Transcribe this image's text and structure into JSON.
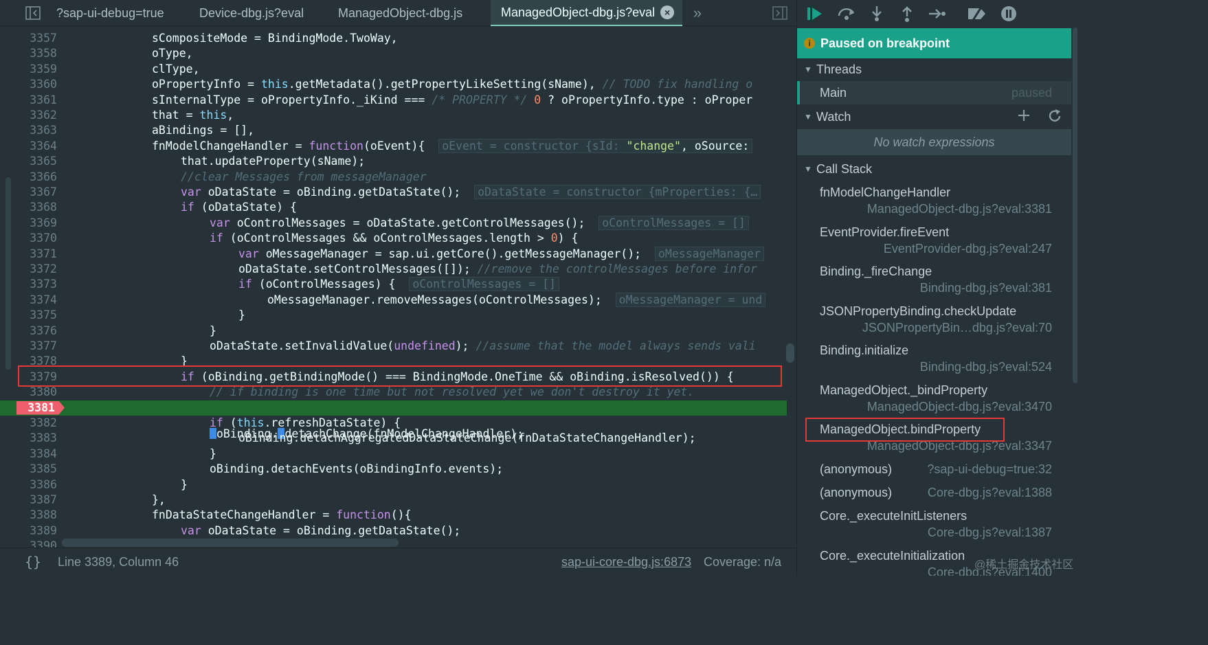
{
  "tabs": [
    {
      "label": "?sap-ui-debug=true",
      "active": false
    },
    {
      "label": "Device-dbg.js?eval",
      "active": false
    },
    {
      "label": "ManagedObject-dbg.js",
      "active": false
    },
    {
      "label": "ManagedObject-dbg.js?eval",
      "active": true,
      "close": "×"
    }
  ],
  "tabs_more": "»",
  "code_lines": [
    {
      "n": "3357"
    },
    {
      "n": "3358"
    },
    {
      "n": "3359"
    },
    {
      "n": "3360"
    },
    {
      "n": "3361"
    },
    {
      "n": "3362"
    },
    {
      "n": "3363"
    },
    {
      "n": "3364"
    },
    {
      "n": "3365"
    },
    {
      "n": "3366"
    },
    {
      "n": "3367"
    },
    {
      "n": "3368"
    },
    {
      "n": "3369"
    },
    {
      "n": "3370"
    },
    {
      "n": "3371"
    },
    {
      "n": "3372"
    },
    {
      "n": "3373"
    },
    {
      "n": "3374"
    },
    {
      "n": "3375"
    },
    {
      "n": "3376"
    },
    {
      "n": "3377"
    },
    {
      "n": "3378"
    },
    {
      "n": "3379"
    },
    {
      "n": "3380"
    },
    {
      "n": "3381"
    },
    {
      "n": "3382"
    },
    {
      "n": "3383"
    },
    {
      "n": "3384"
    },
    {
      "n": "3385"
    },
    {
      "n": "3386"
    },
    {
      "n": "3387"
    },
    {
      "n": "3388"
    },
    {
      "n": "3389"
    },
    {
      "n": "3390"
    }
  ],
  "code_text": {
    "l3357": "sCompositeMode = BindingMode.TwoWay,",
    "l3358": "oType,",
    "l3359": "clType,",
    "l3360a": "oPropertyInfo = ",
    "l3360b": "this",
    "l3360c": ".getMetadata().getPropertyLikeSetting(sName), ",
    "l3360d": "// TODO fix handling o",
    "l3361a": "sInternalType = oPropertyInfo._iKind === ",
    "l3361b": "/* PROPERTY */",
    "l3361c": " 0",
    "l3361d": " ? oPropertyInfo.type : oProper",
    "l3362a": "that = ",
    "l3362b": "this",
    "l3362c": ",",
    "l3363": "aBindings = [],",
    "l3364a": "fnModelChangeHandler = ",
    "l3364b": "function",
    "l3364c": "(oEvent){",
    "l3364d": "oEvent = constructor {sId: ",
    "l3364e": "\"change\"",
    "l3364f": ", oSource:",
    "l3365": "that.updateProperty(sName);",
    "l3366": "//clear Messages from messageManager",
    "l3367a": "var",
    "l3367b": " oDataState = oBinding.getDataState();",
    "l3367c": "oDataState = constructor {mProperties: {…",
    "l3368a": "if",
    "l3368b": " (oDataState) {",
    "l3369a": "var",
    "l3369b": " oControlMessages = oDataState.getControlMessages();",
    "l3369c": "oControlMessages = []",
    "l3370a": "if",
    "l3370b": " (oControlMessages && oControlMessages.length > ",
    "l3370c": "0",
    "l3370d": ") {",
    "l3371a": "var",
    "l3371b": " oMessageManager = sap.ui.getCore().getMessageManager();",
    "l3371c": "oMessageManager",
    "l3372a": "oDataState.setControlMessages([]); ",
    "l3372b": "//remove the controlMessages before infor",
    "l3373a": "if",
    "l3373b": " (oControlMessages) {",
    "l3373c": "oControlMessages = []",
    "l3374a": "oMessageManager.removeMessages(oControlMessages);",
    "l3374b": "oMessageManager = und",
    "l3375": "}",
    "l3376": "}",
    "l3377a": "oDataState.setInvalidValue(",
    "l3377b": "undefined",
    "l3377c": "); ",
    "l3377d": "//assume that the model always sends vali",
    "l3378": "}",
    "l3379a": "if",
    "l3379b": " (oBinding.getBindingMode() === BindingMode.OneTime && oBinding.isResolved()) {",
    "l3380": "// if binding is one time but not resolved yet we don't destroy it yet.",
    "l3381a": "oBinding.",
    "l3381b": "detachChange(fnModelChangeHandler);",
    "l3382a": "if",
    "l3382b": " (",
    "l3382c": "this",
    "l3382d": ".refreshDataState) {",
    "l3383": "oBinding.detachAggregatedDataStateChange(fnDataStateChangeHandler);",
    "l3384": "}",
    "l3385": "oBinding.detachEvents(oBindingInfo.events);",
    "l3386": "}",
    "l3387": "},",
    "l3388a": "fnDataStateChangeHandler = ",
    "l3388b": "function",
    "l3388c": "(){",
    "l3389a": "var",
    "l3389b": " oDataState = oBinding.getDataState();"
  },
  "breakpoint_line": "3381",
  "status": {
    "braces": "{}",
    "position": "Line 3389, Column 46",
    "source_link": "sap-ui-core-dbg.js:6873",
    "coverage": "Coverage: n/a"
  },
  "debugger": {
    "paused_banner": "Paused on breakpoint",
    "threads_header": "Threads",
    "thread": {
      "name": "Main",
      "state": "paused"
    },
    "watch_header": "Watch",
    "no_watch": "No watch expressions",
    "call_stack_header": "Call Stack",
    "frames": [
      {
        "fn": "fnModelChangeHandler",
        "loc": "ManagedObject-dbg.js?eval:3381"
      },
      {
        "fn": "EventProvider.fireEvent",
        "loc": "EventProvider-dbg.js?eval:247"
      },
      {
        "fn": "Binding._fireChange",
        "loc": "Binding-dbg.js?eval:381"
      },
      {
        "fn": "JSONPropertyBinding.checkUpdate",
        "loc": "JSONPropertyBin…dbg.js?eval:70"
      },
      {
        "fn": "Binding.initialize",
        "loc": "Binding-dbg.js?eval:524"
      },
      {
        "fn": "ManagedObject._bindProperty",
        "loc": "ManagedObject-dbg.js?eval:3470"
      },
      {
        "fn": "ManagedObject.bindProperty",
        "loc": "ManagedObject-dbg.js?eval:3347"
      },
      {
        "fn": "(anonymous)",
        "loc": "?sap-ui-debug=true:32"
      },
      {
        "fn": "(anonymous)",
        "loc": "Core-dbg.js?eval:1388"
      },
      {
        "fn": "Core._executeInitListeners",
        "loc": "Core-dbg.js?eval:1387"
      },
      {
        "fn": "Core._executeInitialization",
        "loc": "Core-dbg.js?eval:1400"
      }
    ]
  },
  "watermark": "@稀土掘金技术社区",
  "colors": {
    "background": "#263238",
    "banner": "#1aa18a",
    "exec_line": "#1e6b2e",
    "breakpoint": "#ef5f6b",
    "annotation_box": "#e53935"
  },
  "icons": [
    "toggle-navigator-icon",
    "more-tabs-icon",
    "toggle-debugger-icon",
    "resume-icon",
    "step-over-icon",
    "step-into-icon",
    "step-out-icon",
    "step-icon",
    "deactivate-breakpoints-icon",
    "pause-on-exceptions-icon",
    "info-icon",
    "add-watch-icon",
    "refresh-watch-icon"
  ]
}
